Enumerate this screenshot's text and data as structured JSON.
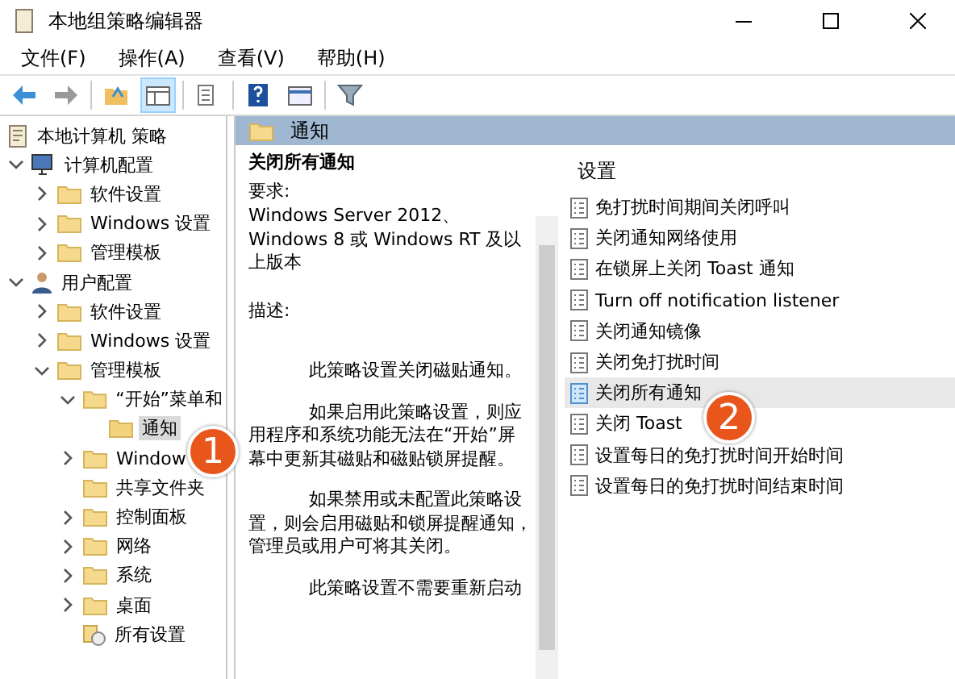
{
  "window": {
    "title": "本地组策略编辑器"
  },
  "menu": [
    "文件(F)",
    "操作(A)",
    "查看(V)",
    "帮助(H)"
  ],
  "toolbar": [
    {
      "selected": false
    },
    {
      "selected": false
    },
    {
      "selected": false
    },
    {
      "selected": true
    },
    {
      "selected": false
    },
    {
      "selected": false
    },
    {
      "selected": false
    },
    {
      "selected": false
    }
  ],
  "tree": [
    {
      "label": "本地计算机 策略",
      "kind": "root",
      "selected": false,
      "children": [
        {
          "label": "计算机配置",
          "kind": "computer",
          "expanded": true,
          "selected": false,
          "children": [
            {
              "label": "软件设置",
              "kind": "folder",
              "expanded": false,
              "selected": false
            },
            {
              "label": "Windows 设置",
              "kind": "folder",
              "expanded": false,
              "selected": false
            },
            {
              "label": "管理模板",
              "kind": "folder",
              "expanded": false,
              "selected": false
            }
          ]
        },
        {
          "label": "用户配置",
          "kind": "user",
          "expanded": true,
          "selected": false,
          "children": [
            {
              "label": "软件设置",
              "kind": "folder",
              "expanded": false,
              "selected": false
            },
            {
              "label": "Windows 设置",
              "kind": "folder",
              "expanded": false,
              "selected": false
            },
            {
              "label": "管理模板",
              "kind": "folder",
              "expanded": true,
              "selected": false,
              "children": [
                {
                  "label": "“开始”菜单和",
                  "kind": "folder",
                  "expanded": true,
                  "selected": false,
                  "children": [
                    {
                      "label": "通知",
                      "kind": "folder",
                      "selected": true
                    }
                  ]
                },
                {
                  "label": "Window",
                  "kind": "folder",
                  "expanded": false,
                  "selected": false
                },
                {
                  "label": "共享文件夹",
                  "kind": "folder",
                  "selected": false
                },
                {
                  "label": "控制面板",
                  "kind": "folder",
                  "expanded": false,
                  "selected": false
                },
                {
                  "label": "网络",
                  "kind": "folder",
                  "expanded": false,
                  "selected": false
                },
                {
                  "label": "系统",
                  "kind": "folder",
                  "expanded": false,
                  "selected": false
                },
                {
                  "label": "桌面",
                  "kind": "folder",
                  "expanded": false,
                  "selected": false
                },
                {
                  "label": "所有设置",
                  "kind": "all",
                  "selected": false
                }
              ]
            }
          ]
        }
      ]
    }
  ],
  "header": {
    "title": "通知"
  },
  "description": {
    "title": "关闭所有通知",
    "requirement_label": "要求:",
    "requirement": "Windows Server 2012、Windows 8 或 Windows RT 及以上版本",
    "description_label": "描述:",
    "paragraphs": [
      "此策略设置关闭磁贴通知。",
      "如果启用此策略设置，则应用程序和系统功能无法在“开始”屏幕中更新其磁贴和磁贴锁屏提醒。",
      "如果禁用或未配置此策略设置，则会启用磁贴和锁屏提醒通知，管理员或用户可将其关闭。",
      "此策略设置不需要重新启动"
    ]
  },
  "settings": {
    "heading": "设置",
    "items": [
      {
        "label": "免打扰时间期间关闭呼叫",
        "selected": false
      },
      {
        "label": "关闭通知网络使用",
        "selected": false
      },
      {
        "label": "在锁屏上关闭 Toast 通知",
        "selected": false
      },
      {
        "label": "Turn off notification listener",
        "selected": false
      },
      {
        "label": "关闭通知镜像",
        "selected": false
      },
      {
        "label": "关闭免打扰时间",
        "selected": false
      },
      {
        "label": "关闭所有通知",
        "selected": true
      },
      {
        "label": "关闭 Toast",
        "selected": false
      },
      {
        "label": "设置每日的免打扰时间开始时间",
        "selected": false
      },
      {
        "label": "设置每日的免打扰时间结束时间",
        "selected": false
      }
    ]
  },
  "callouts": [
    "1",
    "2"
  ]
}
